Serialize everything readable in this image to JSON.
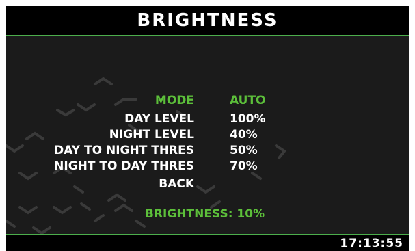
{
  "header": {
    "title": "BRIGHTNESS"
  },
  "menu": {
    "items": [
      {
        "label": "MODE",
        "value": "AUTO",
        "selected": true
      },
      {
        "label": "DAY LEVEL",
        "value": "100%",
        "selected": false
      },
      {
        "label": "NIGHT LEVEL",
        "value": "40%",
        "selected": false
      },
      {
        "label": "DAY TO NIGHT THRES",
        "value": "50%",
        "selected": false
      },
      {
        "label": "NIGHT TO DAY THRES",
        "value": "70%",
        "selected": false
      },
      {
        "label": "BACK",
        "value": "",
        "selected": false
      }
    ]
  },
  "status": {
    "text": "BRIGHTNESS: 10%"
  },
  "footer": {
    "clock": "17:13:55"
  },
  "colors": {
    "background": "#1b1b1b",
    "bars": "#000000",
    "accent_green": "#5cbf3a",
    "divider_green": "#4cae4c",
    "text": "#ffffff"
  }
}
